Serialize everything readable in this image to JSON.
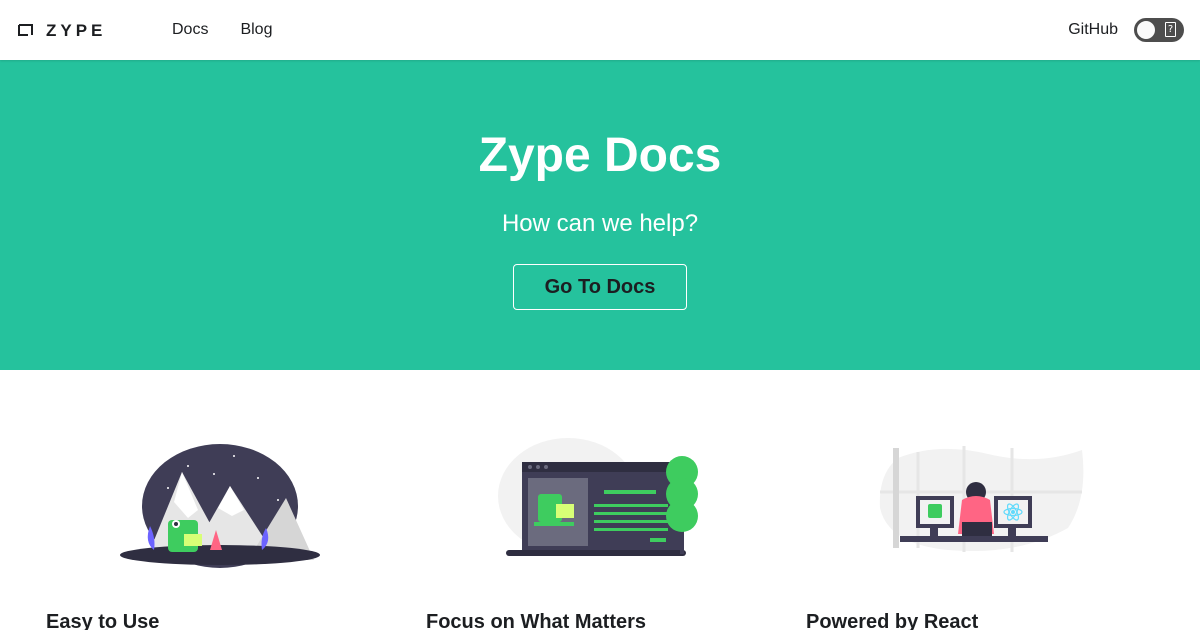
{
  "navbar": {
    "brand": "ZYPE",
    "links": [
      "Docs",
      "Blog"
    ],
    "github": "GitHub",
    "theme_toggle_icon": "dark-mode-toggle-icon"
  },
  "hero": {
    "title": "Zype Docs",
    "subtitle": "How can we help?",
    "button": "Go To Docs",
    "background": "#25c29d"
  },
  "features": [
    {
      "title": "Easy to Use",
      "illustration": "mountain-campfire-illustration"
    },
    {
      "title": "Focus on What Matters",
      "illustration": "browser-tree-illustration"
    },
    {
      "title": "Powered by React",
      "illustration": "developer-monitors-illustration"
    }
  ]
}
